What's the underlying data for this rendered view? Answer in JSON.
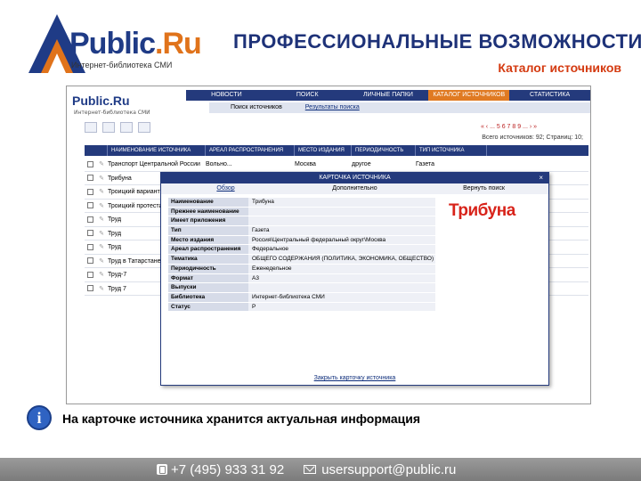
{
  "brand": {
    "logo_main": "Public",
    "logo_accent": ".Ru",
    "logo_sub": "Интернет-библиотека СМИ"
  },
  "header": {
    "title": "ПРОФЕССИОНАЛЬНЫЕ ВОЗМОЖНОСТИ",
    "subtitle": "Каталог источников"
  },
  "app": {
    "logo": "Public.Ru",
    "logo_sub": "Интернет-библиотека СМИ",
    "nav": [
      "НОВОСТИ",
      "ПОИСК",
      "ЛИЧНЫЕ ПАПКИ",
      "КАТАЛОГ ИСТОЧНИКОВ",
      "СТАТИСТИКА"
    ],
    "nav_active": 3,
    "subnav": [
      "Поиск источников",
      "Результаты поиска"
    ],
    "pager": "« ‹ ... 5 6 7 8 9 ... › »",
    "totals": "Всего источников: 92; Страниц: 10;",
    "columns": [
      "НАИМЕНОВАНИЕ ИСТОЧНИКА",
      "АРЕАЛ РАСПРОСТРАНЕНИЯ",
      "МЕСТО ИЗДАНИЯ",
      "ПЕРИОДИЧНОСТЬ",
      "ТИП ИСТОЧНИКА"
    ],
    "rows": [
      {
        "name": "Транспорт Центральной России",
        "area": "Вольно...",
        "place": "Москва",
        "period": "другое",
        "type": "Газета"
      },
      {
        "name": "Трибуна",
        "area": "",
        "place": "",
        "period": "",
        "type": ""
      },
      {
        "name": "Троицкий вариант",
        "area": "",
        "place": "",
        "period": "",
        "type": ""
      },
      {
        "name": "Троицкий протестант",
        "area": "",
        "place": "",
        "period": "",
        "type": ""
      },
      {
        "name": "Труд",
        "area": "",
        "place": "",
        "period": "",
        "type": ""
      },
      {
        "name": "Труд",
        "area": "",
        "place": "",
        "period": "",
        "type": ""
      },
      {
        "name": "Труд",
        "area": "",
        "place": "",
        "period": "",
        "type": ""
      },
      {
        "name": "Труд в Татарстане",
        "area": "",
        "place": "",
        "period": "",
        "type": ""
      },
      {
        "name": "Труд-7",
        "area": "",
        "place": "",
        "period": "",
        "type": ""
      },
      {
        "name": "Труд 7",
        "area": "",
        "place": "",
        "period": "",
        "type": ""
      }
    ]
  },
  "card": {
    "title": "КАРТОЧКА ИСТОЧНИКА",
    "close": "×",
    "tabs": [
      "Обзор",
      "Дополнительно",
      "Вернуть поиск"
    ],
    "fields": [
      {
        "label": "Наименование",
        "value": "Трибуна"
      },
      {
        "label": "Прежнее наименование",
        "value": ""
      },
      {
        "label": "Имеет приложения",
        "value": ""
      },
      {
        "label": "Тип",
        "value": "Газета"
      },
      {
        "label": "Место издания",
        "value": "Россия\\Центральный федеральный округ\\Москва"
      },
      {
        "label": "Ареал распространения",
        "value": "Федеральное"
      },
      {
        "label": "Тематика",
        "value": "ОБЩЕГО СОДЕРЖАНИЯ (ПОЛИТИКА, ЭКОНОМИКА, ОБЩЕСТВО)"
      },
      {
        "label": "Периодичность",
        "value": "Еженедельное"
      },
      {
        "label": "Формат",
        "value": "А3"
      },
      {
        "label": "Выпуски",
        "value": ""
      },
      {
        "label": "Библиотека",
        "value": "Интернет-библиотека СМИ"
      },
      {
        "label": "Статус",
        "value": "Р"
      }
    ],
    "logo_text": "Трибуна",
    "footer": "Закрыть карточку источника"
  },
  "note": "На карточке источника хранится актуальная информация",
  "footer": {
    "phone": "+7 (495) 933 31 92",
    "email": "usersupport@public.ru"
  },
  "colors": {
    "navy": "#243a7c",
    "orange": "#e07a22",
    "red_title": "#d43a10"
  }
}
